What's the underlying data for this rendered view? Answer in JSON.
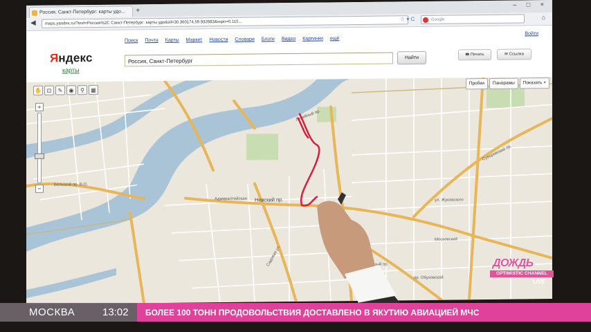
{
  "browser": {
    "tab_title": "Россия, Санкт-Петербург: карты удо...",
    "new_tab": "+",
    "window_controls": "– □ ×",
    "url": "maps.yandex.ru/?text=Россия%2C Санкт-Петербург: карты удо&sll=30.360174,59.932683&sspn=0.115...",
    "search_placeholder": "Google",
    "search_engine_icon": "google-icon",
    "nav_icons": "☆ ▾ C"
  },
  "yandex": {
    "logo_first": "Я",
    "logo_rest": "ндекс",
    "logo_sub": "карты",
    "services": [
      "Поиск",
      "Почта",
      "Карты",
      "Маркет",
      "Новости",
      "Словари",
      "Блоги",
      "Видео",
      "Картинки",
      "ещё"
    ],
    "login": "Войти",
    "location_value": "Россия, Санкт-Петербург",
    "find_label": "Найти",
    "print_label": "Печать",
    "link_label": "Ссылка"
  },
  "map": {
    "layers": [
      "Пробки",
      "Панорамы",
      "Показать ×"
    ],
    "streets": [
      "Невский пр.",
      "Адмиралтейская",
      "Литейный пр.",
      "Суворовский пр.",
      "ул. Жуковского",
      "Московский",
      "Загородный пр.",
      "Садовая ул.",
      "Большой пр. В.О.",
      "пр. Обуховской"
    ],
    "zoom_plus": "+",
    "zoom_minus": "−"
  },
  "broadcast": {
    "channel_name": "ДОЖДЬ",
    "channel_tagline": "OPTIMISTIC CHANNEL",
    "live": "LIVE",
    "city": "МОСКВА",
    "time": "13:02",
    "headline": "БОЛЕЕ 100 ТОНН ПРОДОВОЛЬСТВИЯ ДОСТАВЛЕНО В ЯКУТИЮ АВИАЦИЕЙ МЧС"
  },
  "colors": {
    "yandex_red": "#e32b1a",
    "water": "#a9c4d6",
    "road_major": "#e7b659",
    "ticker_pink": "#e0419a",
    "marker_red": "#d61e3d"
  }
}
